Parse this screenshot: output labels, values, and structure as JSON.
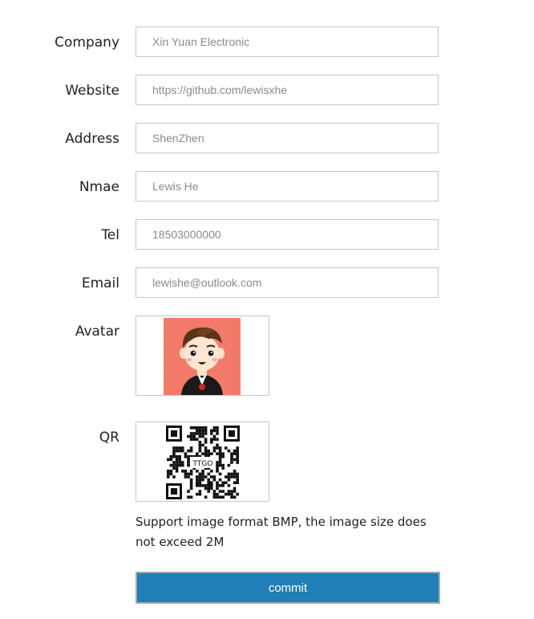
{
  "form": {
    "fields": [
      {
        "label": "Company",
        "placeholder": "Xin Yuan Electronic"
      },
      {
        "label": "Website",
        "placeholder": "https://github.com/lewisxhe"
      },
      {
        "label": "Address",
        "placeholder": "ShenZhen"
      },
      {
        "label": "Nmae",
        "placeholder": "Lewis He"
      },
      {
        "label": "Tel",
        "placeholder": "18503000000"
      },
      {
        "label": "Email",
        "placeholder": "lewishe@outlook.com"
      }
    ],
    "avatar_label": "Avatar",
    "qr_label": "QR",
    "qr_center_text": "TTGO",
    "note": "Support image format BMP, the image size does not exceed 2M",
    "commit_label": "commit"
  },
  "colors": {
    "button_bg": "#1f7fb6",
    "avatar_bg": "#f37a69"
  }
}
